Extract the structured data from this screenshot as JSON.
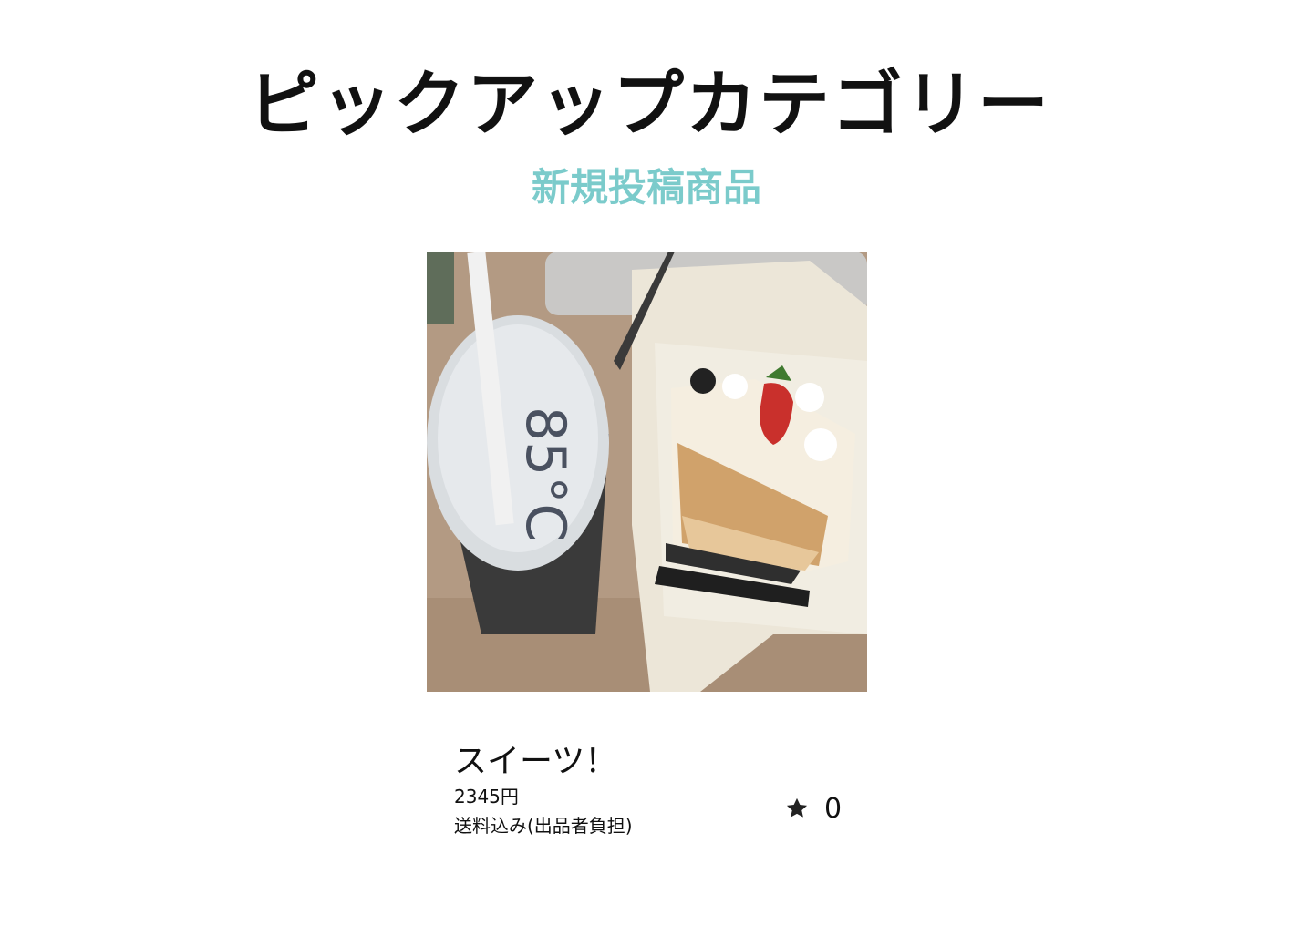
{
  "header": {
    "title": "ピックアップカテゴリー"
  },
  "section": {
    "title": "新規投稿商品"
  },
  "items": [
    {
      "name": "スイーツ！",
      "price": "2345円",
      "shipping": "送料込み(出品者負担)",
      "likes": "0",
      "image_icon": "product-photo",
      "like_icon": "star-icon"
    }
  ],
  "colors": {
    "accent": "#7bcbcb",
    "text": "#111111"
  }
}
